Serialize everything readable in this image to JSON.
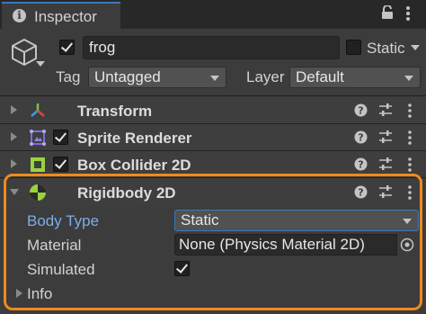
{
  "tab": {
    "title": "Inspector",
    "icon": "info-icon"
  },
  "header": {
    "active_checked": true,
    "name": "frog",
    "static_checked": false,
    "static_label": "Static",
    "tag_label": "Tag",
    "tag_value": "Untagged",
    "layer_label": "Layer",
    "layer_value": "Default"
  },
  "components": [
    {
      "title": "Transform",
      "icon": "transform-icon",
      "has_checkbox": false
    },
    {
      "title": "Sprite Renderer",
      "icon": "sprite-renderer-icon",
      "has_checkbox": true,
      "checked": true
    },
    {
      "title": "Box Collider 2D",
      "icon": "box-collider-icon",
      "has_checkbox": true,
      "checked": true
    },
    {
      "title": "Rigidbody 2D",
      "icon": "rigidbody-icon",
      "has_checkbox": false,
      "expanded": true
    }
  ],
  "rigidbody": {
    "body_type_label": "Body Type",
    "body_type_value": "Static",
    "material_label": "Material",
    "material_value": "None (Physics Material 2D)",
    "simulated_label": "Simulated",
    "simulated_checked": true,
    "info_label": "Info"
  },
  "colors": {
    "highlight": "#f08a1b",
    "active_label": "#7baee8",
    "tab_accent": "#3a79bb"
  }
}
